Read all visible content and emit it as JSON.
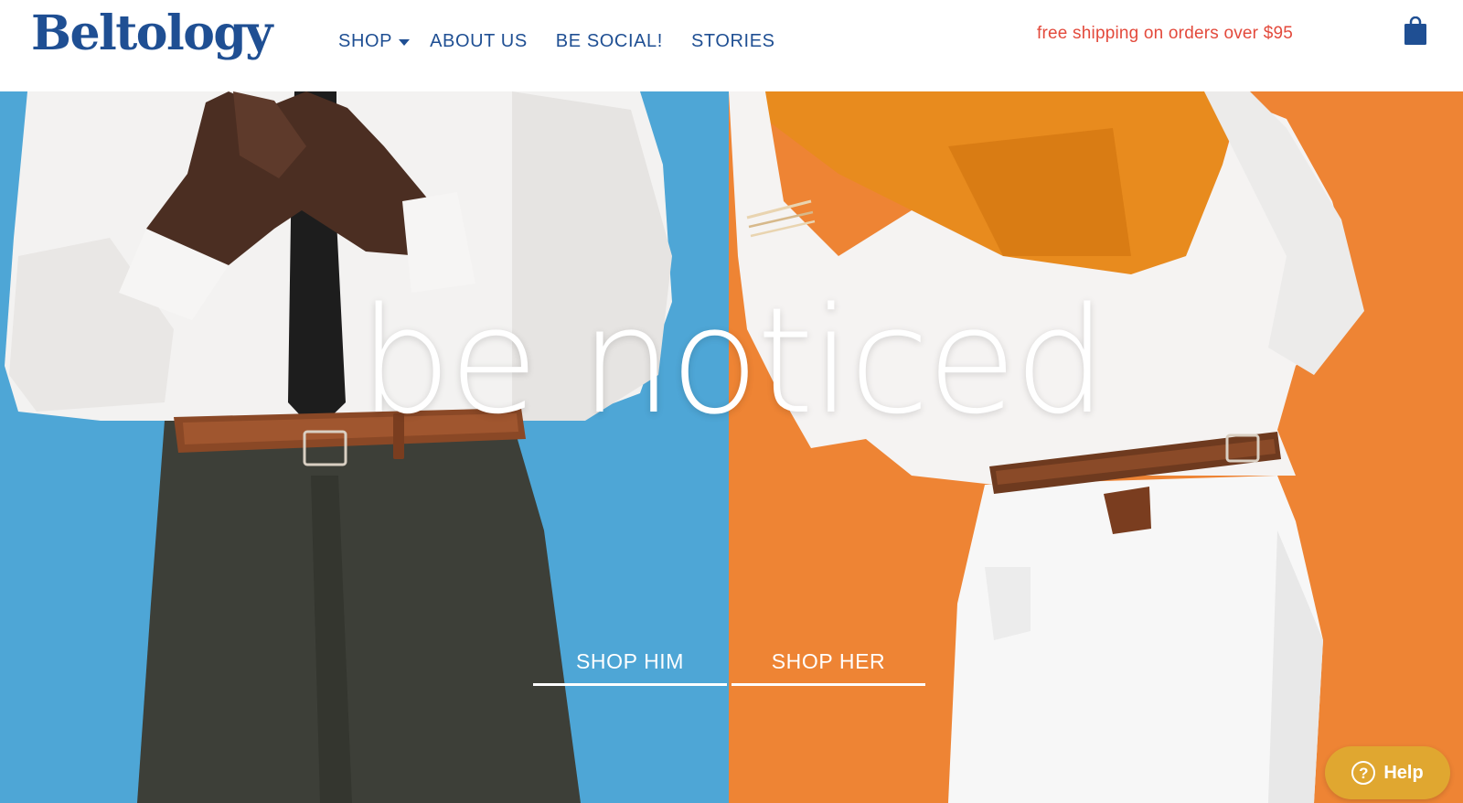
{
  "brand": {
    "name": "Beltology",
    "color": "#1f4f93"
  },
  "nav": {
    "items": [
      {
        "label": "SHOP"
      },
      {
        "label": "ABOUT US"
      },
      {
        "label": "BE SOCIAL!"
      },
      {
        "label": "STORIES"
      }
    ]
  },
  "promo": {
    "shipping": "free shipping on orders over $95",
    "color": "#e34a3c"
  },
  "cart": {
    "icon": "shopping-bag-icon"
  },
  "hero": {
    "tagline": "be noticed",
    "left_bg": "#4ea6d6",
    "right_bg": "#ee8434",
    "cta_him": "SHOP HIM",
    "cta_her": "SHOP HER"
  },
  "help": {
    "label": "Help",
    "icon": "question-circle-icon",
    "color": "#e0a730"
  }
}
